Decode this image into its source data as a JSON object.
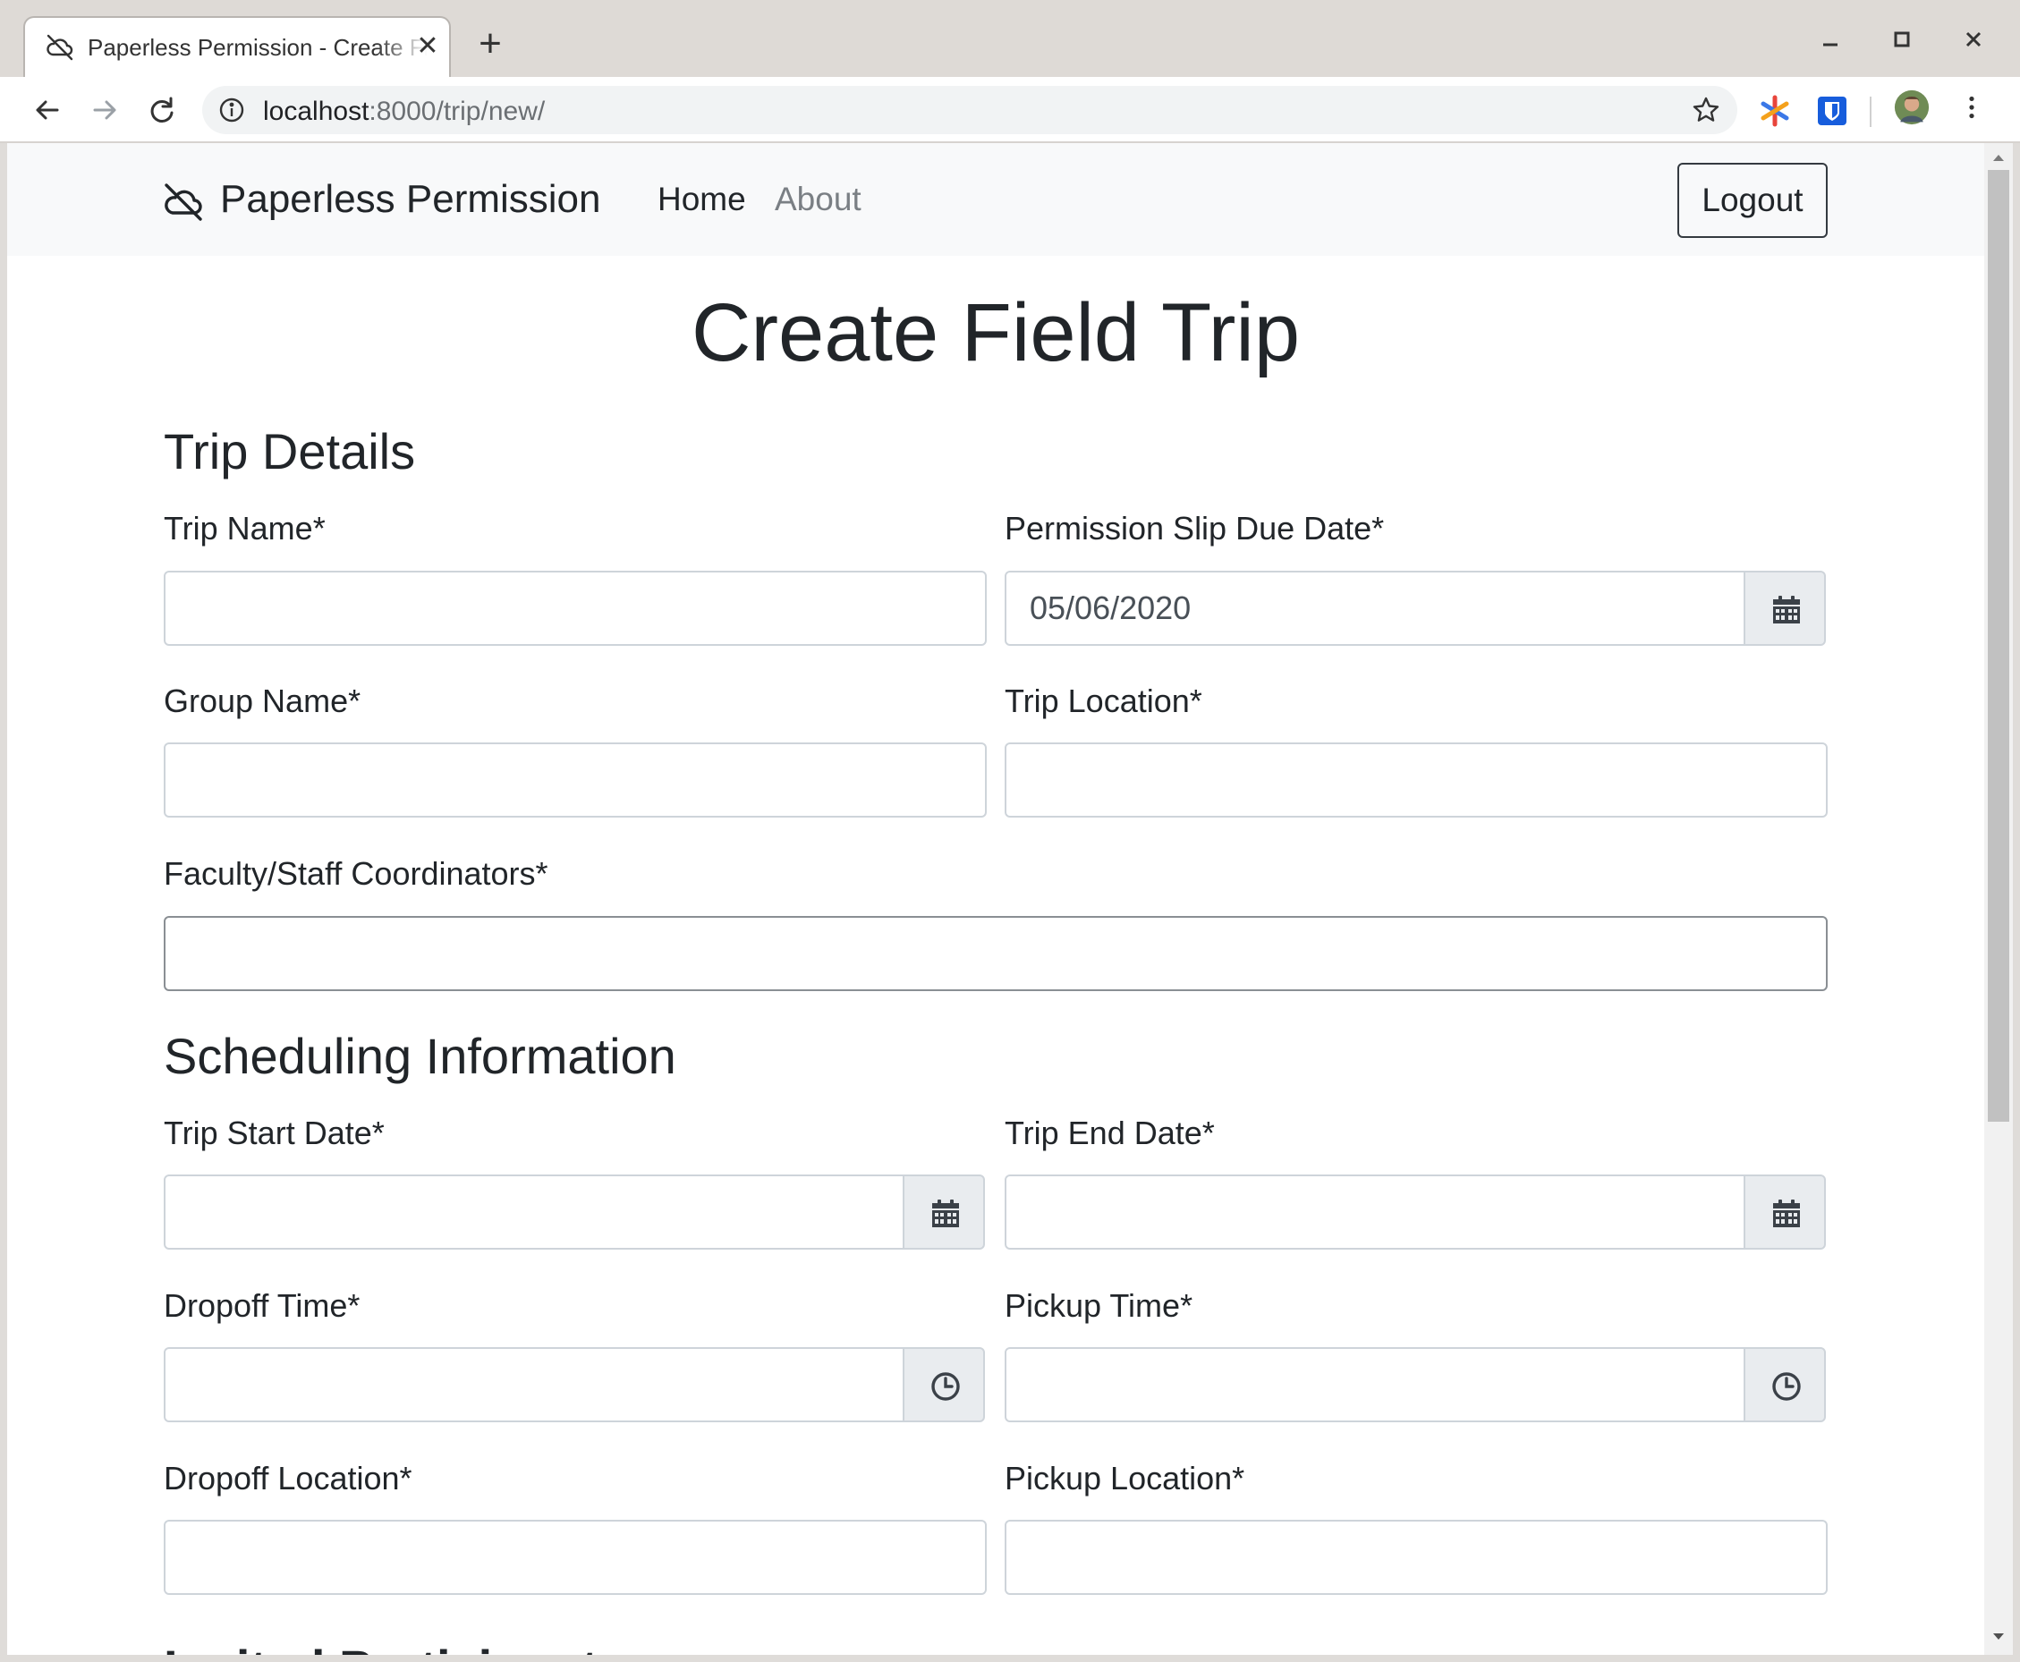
{
  "browser": {
    "tab_title": "Paperless Permission - Create Field Trip",
    "tab_icon": "paperless-cloud-icon",
    "url_host": "localhost",
    "url_rest": ":8000/trip/new/"
  },
  "navbar": {
    "brand": "Paperless Permission",
    "home_label": "Home",
    "about_label": "About",
    "logout_label": "Logout"
  },
  "page": {
    "title": "Create Field Trip"
  },
  "sections": {
    "trip_details": "Trip Details",
    "scheduling": "Scheduling Information",
    "invited": "Invited Participants"
  },
  "fields": {
    "trip_name": {
      "label": "Trip Name*",
      "value": ""
    },
    "due_date": {
      "label": "Permission Slip Due Date*",
      "value": "05/06/2020",
      "icon": "calendar-icon"
    },
    "group_name": {
      "label": "Group Name*",
      "value": ""
    },
    "trip_location": {
      "label": "Trip Location*",
      "value": ""
    },
    "coordinators": {
      "label": "Faculty/Staff Coordinators*",
      "value": ""
    },
    "start_date": {
      "label": "Trip Start Date*",
      "value": "",
      "icon": "calendar-icon"
    },
    "end_date": {
      "label": "Trip End Date*",
      "value": "",
      "icon": "calendar-icon"
    },
    "dropoff_time": {
      "label": "Dropoff Time*",
      "value": "",
      "icon": "clock-icon"
    },
    "pickup_time": {
      "label": "Pickup Time*",
      "value": "",
      "icon": "clock-icon"
    },
    "dropoff_location": {
      "label": "Dropoff Location*",
      "value": ""
    },
    "pickup_location": {
      "label": "Pickup Location*",
      "value": ""
    }
  },
  "colors": {
    "navbar_bg": "#f8f9fa",
    "addon_bg": "#e9ecef",
    "input_border": "#ced4da",
    "muted_link": "#7a7f84"
  }
}
